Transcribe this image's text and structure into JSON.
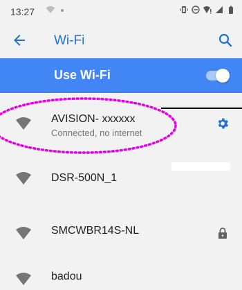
{
  "status_bar": {
    "time": "13:27",
    "left_icons": [
      "wifi-signal-icon",
      "dot-icon"
    ],
    "right_icons": [
      "vibrate-icon",
      "do-not-disturb-icon",
      "wifi-alert-icon",
      "cell-signal-icon",
      "battery-icon"
    ]
  },
  "app_bar": {
    "title": "Wi-Fi",
    "back_icon": "arrow-left-icon",
    "search_icon": "search-icon",
    "accent_color": "#1e73d4"
  },
  "wifi_toggle": {
    "label": "Use Wi-Fi",
    "enabled": true,
    "bar_color": "#4285f4"
  },
  "networks": [
    {
      "name": "AVISION- xxxxxx",
      "status": "Connected, no internet",
      "action_icon": "gear-icon",
      "action_color": "#1e73d4",
      "highlighted": true
    },
    {
      "name": "DSR-500N_1",
      "status": "",
      "action_icon": ""
    },
    {
      "name": "SMCWBR14S-NL",
      "status": "",
      "action_icon": "lock-icon"
    },
    {
      "name": "badou",
      "status": "",
      "action_icon": ""
    }
  ],
  "annotation": {
    "highlight_color": "#e600e6"
  }
}
